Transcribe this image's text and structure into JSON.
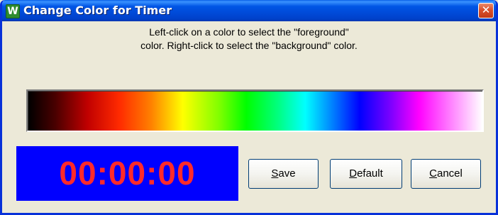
{
  "window": {
    "title": "Change Color for Timer",
    "app_icon_letter": "W",
    "close_glyph": "✕"
  },
  "instructions": {
    "line1": "Left-click on a color to select the \"foreground\"",
    "line2": "color. Right-click to select the \"background\" color."
  },
  "spectrum": {
    "colors": [
      "#000000",
      "#C00000",
      "#FF8000",
      "#FFFF00",
      "#00FF00",
      "#00FFFF",
      "#0000FF",
      "#FF00FF",
      "#FFFFFF"
    ]
  },
  "preview": {
    "time": "00:00:00",
    "foreground_color": "#FF2A2A",
    "background_color": "#0000FF"
  },
  "buttons": {
    "save": {
      "accel": "S",
      "rest": "ave"
    },
    "default": {
      "accel": "D",
      "rest": "efault"
    },
    "cancel": {
      "accel": "C",
      "rest": "ancel"
    }
  }
}
